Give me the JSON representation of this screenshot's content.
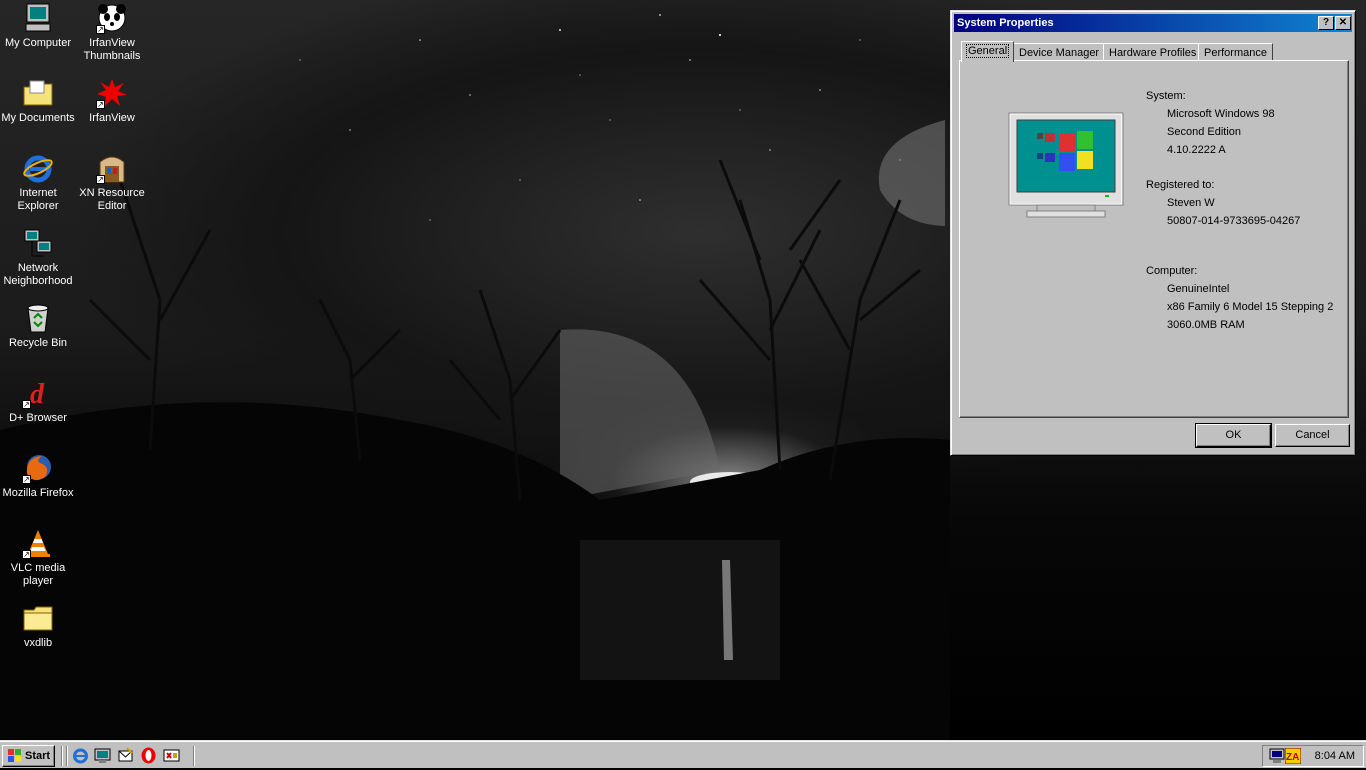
{
  "desktop": {
    "icons": [
      {
        "label": "My Computer"
      },
      {
        "label": "IrfanView Thumbnails"
      },
      {
        "label": "My Documents"
      },
      {
        "label": "IrfanView"
      },
      {
        "label": "Internet Explorer"
      },
      {
        "label": "XN Resource Editor"
      },
      {
        "label": "Network Neighborhood"
      },
      {
        "label": "Recycle Bin"
      },
      {
        "label": "D+ Browser"
      },
      {
        "label": "Mozilla Firefox"
      },
      {
        "label": "VLC media player"
      },
      {
        "label": "vxdlib"
      }
    ]
  },
  "window": {
    "title": "System Properties",
    "help_glyph": "?",
    "close_glyph": "✕",
    "tabs": [
      {
        "label": "General",
        "active": true
      },
      {
        "label": "Device Manager"
      },
      {
        "label": "Hardware Profiles"
      },
      {
        "label": "Performance"
      }
    ],
    "system": {
      "heading": "System:",
      "lines": [
        "Microsoft Windows 98",
        "Second Edition",
        "4.10.2222 A"
      ]
    },
    "registered": {
      "heading": "Registered to:",
      "lines": [
        "Steven W",
        "50807-014-9733695-04267"
      ]
    },
    "computer": {
      "heading": "Computer:",
      "lines": [
        "GenuineIntel",
        "x86 Family 6 Model 15 Stepping 2",
        "3060.0MB RAM"
      ]
    },
    "ok_label": "OK",
    "cancel_label": "Cancel"
  },
  "taskbar": {
    "start_label": "Start",
    "clock": "8:04 AM",
    "quicklaunch": [
      "internet-explorer-icon",
      "show-desktop-icon",
      "outlook-express-icon",
      "opera-icon",
      "xn-editor-icon"
    ],
    "tray": [
      "monitor-icon",
      "zonealarm-icon"
    ]
  }
}
